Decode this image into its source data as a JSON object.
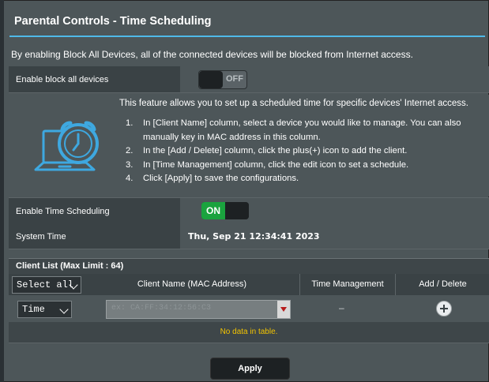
{
  "page": {
    "title": "Parental Controls - Time Scheduling",
    "description": "By enabling Block All Devices, all of the connected devices will be blocked from Internet access."
  },
  "block_all": {
    "label": "Enable block all devices",
    "state": "OFF"
  },
  "info": {
    "intro": "This feature allows you to set up a scheduled time for specific devices' Internet access.",
    "steps": [
      {
        "n": "1.",
        "text": "In [Client Name] column, select a device you would like to manage. You can also"
      },
      {
        "n": "",
        "text": "manually key in MAC address in this column."
      },
      {
        "n": "2.",
        "text": "In the [Add / Delete] column, click the plus(+) icon to add the client."
      },
      {
        "n": "3.",
        "text": "In [Time Management] column, click the edit icon to set a schedule."
      },
      {
        "n": "4.",
        "text": "Click [Apply] to save the configurations."
      }
    ],
    "icon": "alarm-clock-laptop-icon"
  },
  "time_scheduling": {
    "label": "Enable Time Scheduling",
    "state": "ON"
  },
  "system_time": {
    "label": "System Time",
    "value": "Thu, Sep 21 12:34:41 2023"
  },
  "client_list": {
    "title": "Client List (Max Limit : 64)",
    "select_all": "Select all",
    "columns": [
      "Client Name (MAC Address)",
      "Time Management",
      "Add / Delete"
    ],
    "row_mode": "Time",
    "mac_placeholder": "ex: CA:FF:34:12:56:C3",
    "time_mgmt_value": "–",
    "add_icon": "plus-circle-icon",
    "empty_text": "No data in table."
  },
  "apply_label": "Apply",
  "colors": {
    "accent_line": "#4fb9e8",
    "toggle_on": "#1aa33e",
    "empty_text": "#f3c400",
    "icon": "#3ea8e0"
  }
}
